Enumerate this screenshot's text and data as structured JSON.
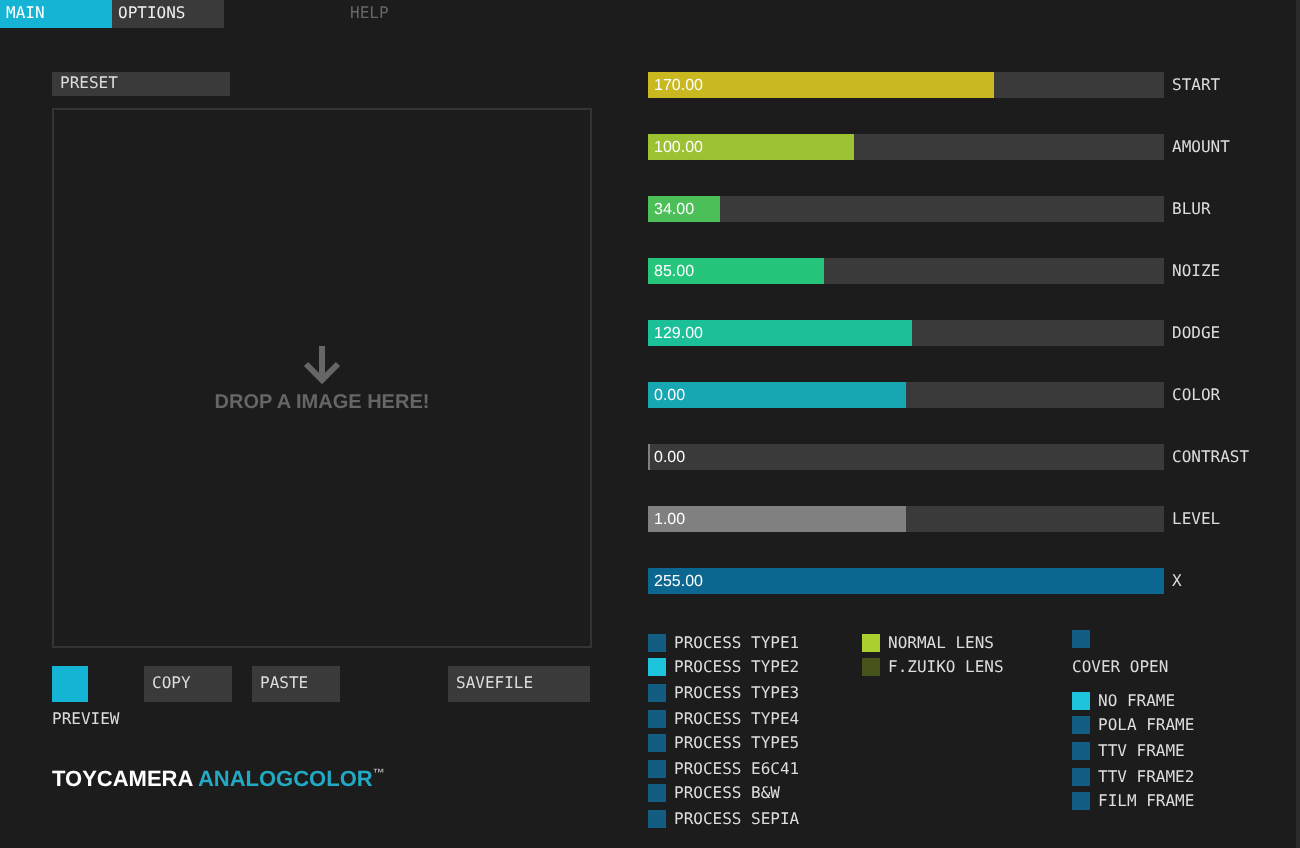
{
  "tabs": [
    {
      "label": "MAIN",
      "selected": true,
      "disabled": false
    },
    {
      "label": "OPTIONS",
      "selected": false,
      "disabled": false
    },
    {
      "label": "HELP",
      "selected": false,
      "disabled": true
    }
  ],
  "preset": {
    "label": "PRESET"
  },
  "drop_area": {
    "text": "DROP A IMAGE HERE!"
  },
  "preview": {
    "label": "PREVIEW",
    "checked": true
  },
  "buttons": [
    "COPY",
    "PASTE",
    "SAVEFILE"
  ],
  "logo": {
    "brand": "TOYCAMERA",
    "product": "ANALOGCOLOR",
    "mark": "™"
  },
  "sliders": [
    {
      "label": "START",
      "reading": "170.00",
      "level": 0.67,
      "color": "#c9b81f"
    },
    {
      "label": "AMOUNT",
      "reading": "100.00",
      "level": 0.4,
      "color": "#9cc132"
    },
    {
      "label": "BLUR",
      "reading": "34.00",
      "level": 0.14,
      "color": "#4dbf59"
    },
    {
      "label": "NOIZE",
      "reading": "85.00",
      "level": 0.34,
      "color": "#25c57c"
    },
    {
      "label": "DODGE",
      "reading": "129.00",
      "level": 0.51,
      "color": "#1bbf98"
    },
    {
      "label": "COLOR",
      "reading": "0.00",
      "level": 0.5,
      "color": "#16a7b2"
    },
    {
      "label": "CONTRAST",
      "reading": "0.00",
      "level": 0,
      "color": "#808080"
    },
    {
      "label": "LEVEL",
      "reading": "1.00",
      "level": 0.5,
      "color": "#808080"
    },
    {
      "label": "X",
      "reading": "255.00",
      "level": 1,
      "color": "#0b6690"
    }
  ],
  "process": [
    {
      "label": "PROCESS TYPE1",
      "selected": false
    },
    {
      "label": "PROCESS TYPE2",
      "selected": true
    },
    {
      "label": "PROCESS TYPE3",
      "selected": false
    },
    {
      "label": "PROCESS TYPE4",
      "selected": false
    },
    {
      "label": "PROCESS TYPE5",
      "selected": false
    },
    {
      "label": "PROCESS E6C41",
      "selected": false
    },
    {
      "label": "PROCESS B&W",
      "selected": false
    },
    {
      "label": "PROCESS SEPIA",
      "selected": false
    }
  ],
  "lenses": [
    {
      "label": "NORMAL LENS",
      "selected": true
    },
    {
      "label": "F.ZUIKO LENS",
      "selected": false
    }
  ],
  "cover": {
    "label": "COVER OPEN",
    "checked": false
  },
  "frames": [
    {
      "label": "NO FRAME",
      "selected": true
    },
    {
      "label": "POLA FRAME",
      "selected": false
    },
    {
      "label": "TTV FRAME",
      "selected": false
    },
    {
      "label": "TTV FRAME2",
      "selected": false
    },
    {
      "label": "FILM FRAME",
      "selected": false
    }
  ]
}
